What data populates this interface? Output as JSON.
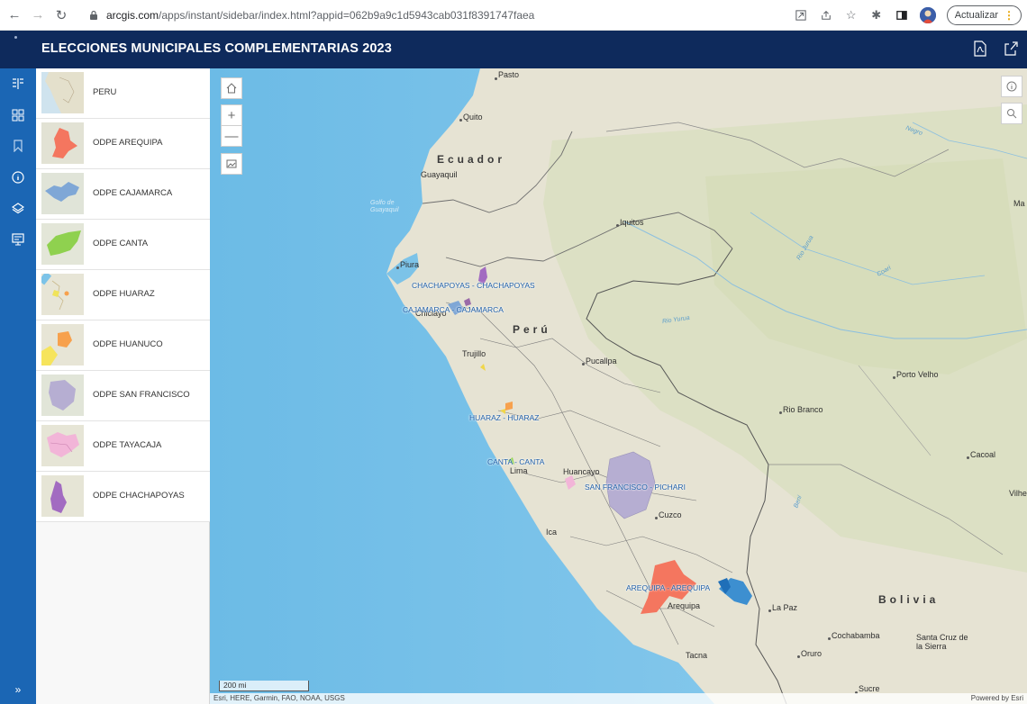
{
  "browser": {
    "url_domain": "arcgis.com",
    "url_path": "/apps/instant/sidebar/index.html?appid=062b9a9c1d5943cab031f8391747faea",
    "update_label": "Actualizar"
  },
  "header": {
    "title": "ELECCIONES MUNICIPALES COMPLEMENTARIAS 2023"
  },
  "list": {
    "items": [
      {
        "label": "PERU"
      },
      {
        "label": "ODPE AREQUIPA"
      },
      {
        "label": "ODPE CAJAMARCA"
      },
      {
        "label": "ODPE CANTA"
      },
      {
        "label": "ODPE HUARAZ"
      },
      {
        "label": "ODPE HUANUCO"
      },
      {
        "label": "ODPE SAN FRANCISCO"
      },
      {
        "label": "ODPE TAYACAJA"
      },
      {
        "label": "ODPE CHACHAPOYAS"
      }
    ]
  },
  "map": {
    "countries": {
      "ecuador": "Ecuador",
      "peru": "Perú",
      "bolivia": "Bolivia"
    },
    "places": {
      "pasto": "Pasto",
      "quito": "Quito",
      "guayaquil": "Guayaquil",
      "iquitos": "Iquitos",
      "piura": "Piura",
      "chiclayo": "Chiclayo",
      "trujillo": "Trujillo",
      "pucallpa": "Pucallpa",
      "lima": "Lima",
      "huancayo": "Huancayo",
      "cuzco": "Cuzco",
      "ica": "Ica",
      "arequipa": "Arequipa",
      "tacna": "Tacna",
      "la_paz": "La Paz",
      "oruro": "Oruro",
      "cochabamba": "Cochabamba",
      "santa_cruz": "Santa Cruz de la Sierra",
      "sucre": "Sucre",
      "porto_velho": "Porto Velho",
      "rio_branco": "Rio Branco",
      "cacoal": "Cacoal",
      "vilhena": "Vilhe",
      "manaus": "Ma"
    },
    "rivers": {
      "negro": "Negro",
      "jurua": "Rio Jurua",
      "jurua2": "Rio Yurua",
      "coari": "Coari",
      "beni": "Beni"
    },
    "sea": {
      "gulf": "Golfo de Guayaquil"
    },
    "odpe_labels": {
      "chachapoyas": "CHACHAPOYAS - CHACHAPOYAS",
      "cajamarca": "CAJAMARCA - CAJAMARCA",
      "huaraz": "HUARAZ - HUARAZ",
      "canta": "CANTA - CANTA",
      "san_francisco": "SAN FRANCISCO - PICHARI",
      "arequipa": "AREQUIPA - AREQUIPA"
    },
    "scale_label": "200 mi",
    "attribution": "Esri, HERE, Garmin, FAO, NOAA, USGS",
    "powered_by": "Powered by Esri"
  },
  "colors": {
    "header_bg": "#0e2a5c",
    "rail_bg": "#1b66b4",
    "water": "#7cc3e8",
    "land": "#e6e3d3",
    "odpe_arequipa": "#f4765f",
    "odpe_cajamarca": "#7fa7d6",
    "odpe_canta": "#8fd14f",
    "odpe_huanuco": "#f7a14d",
    "odpe_san_francisco": "#b6aed2",
    "odpe_tayacaja": "#f2b5d8",
    "odpe_chachapoyas": "#a26bc1"
  }
}
